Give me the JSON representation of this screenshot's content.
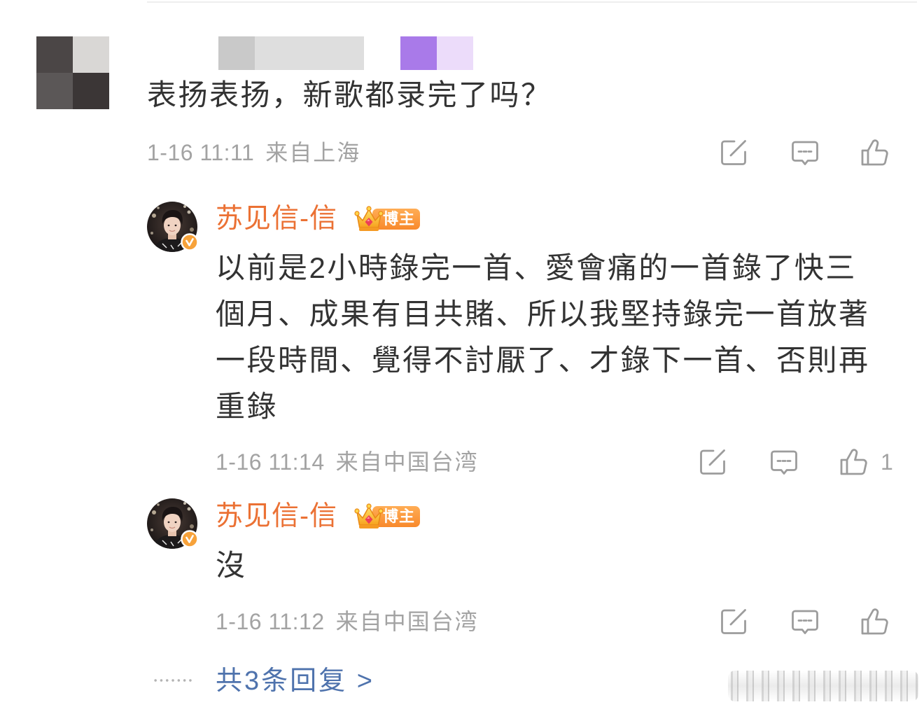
{
  "comment": {
    "text": "表扬表扬，新歌都录完了吗？",
    "time": "1-16 11:11",
    "location": "来自上海"
  },
  "replies": [
    {
      "author": "苏见信-信",
      "badge": "博主",
      "lines": [
        "以前是2小時錄完一首、愛會痛的一首錄了快三",
        "個月、成果有目共賭、所以我堅持錄完一首放著",
        "一段時間、覺得不討厭了、才錄下一首、否則再",
        "重錄"
      ],
      "time": "1-16 11:14",
      "location": "来自中国台湾",
      "like_count": "1"
    },
    {
      "author": "苏见信-信",
      "badge": "博主",
      "lines": [
        "沒"
      ],
      "time": "1-16 11:12",
      "location": "来自中国台湾"
    }
  ],
  "more_replies": "共3条回复 >",
  "icons": {
    "forward": "forward-icon",
    "comment": "comment-icon",
    "like": "like-icon",
    "verified": "verified-icon",
    "crown": "crown-icon"
  },
  "colors": {
    "text": "#333333",
    "meta": "#a3a3a3",
    "author": "#eb7134",
    "link": "#4f73ad",
    "icon": "#9c9c9c",
    "badge": "#f8892c",
    "verified": "#f7a23a"
  }
}
